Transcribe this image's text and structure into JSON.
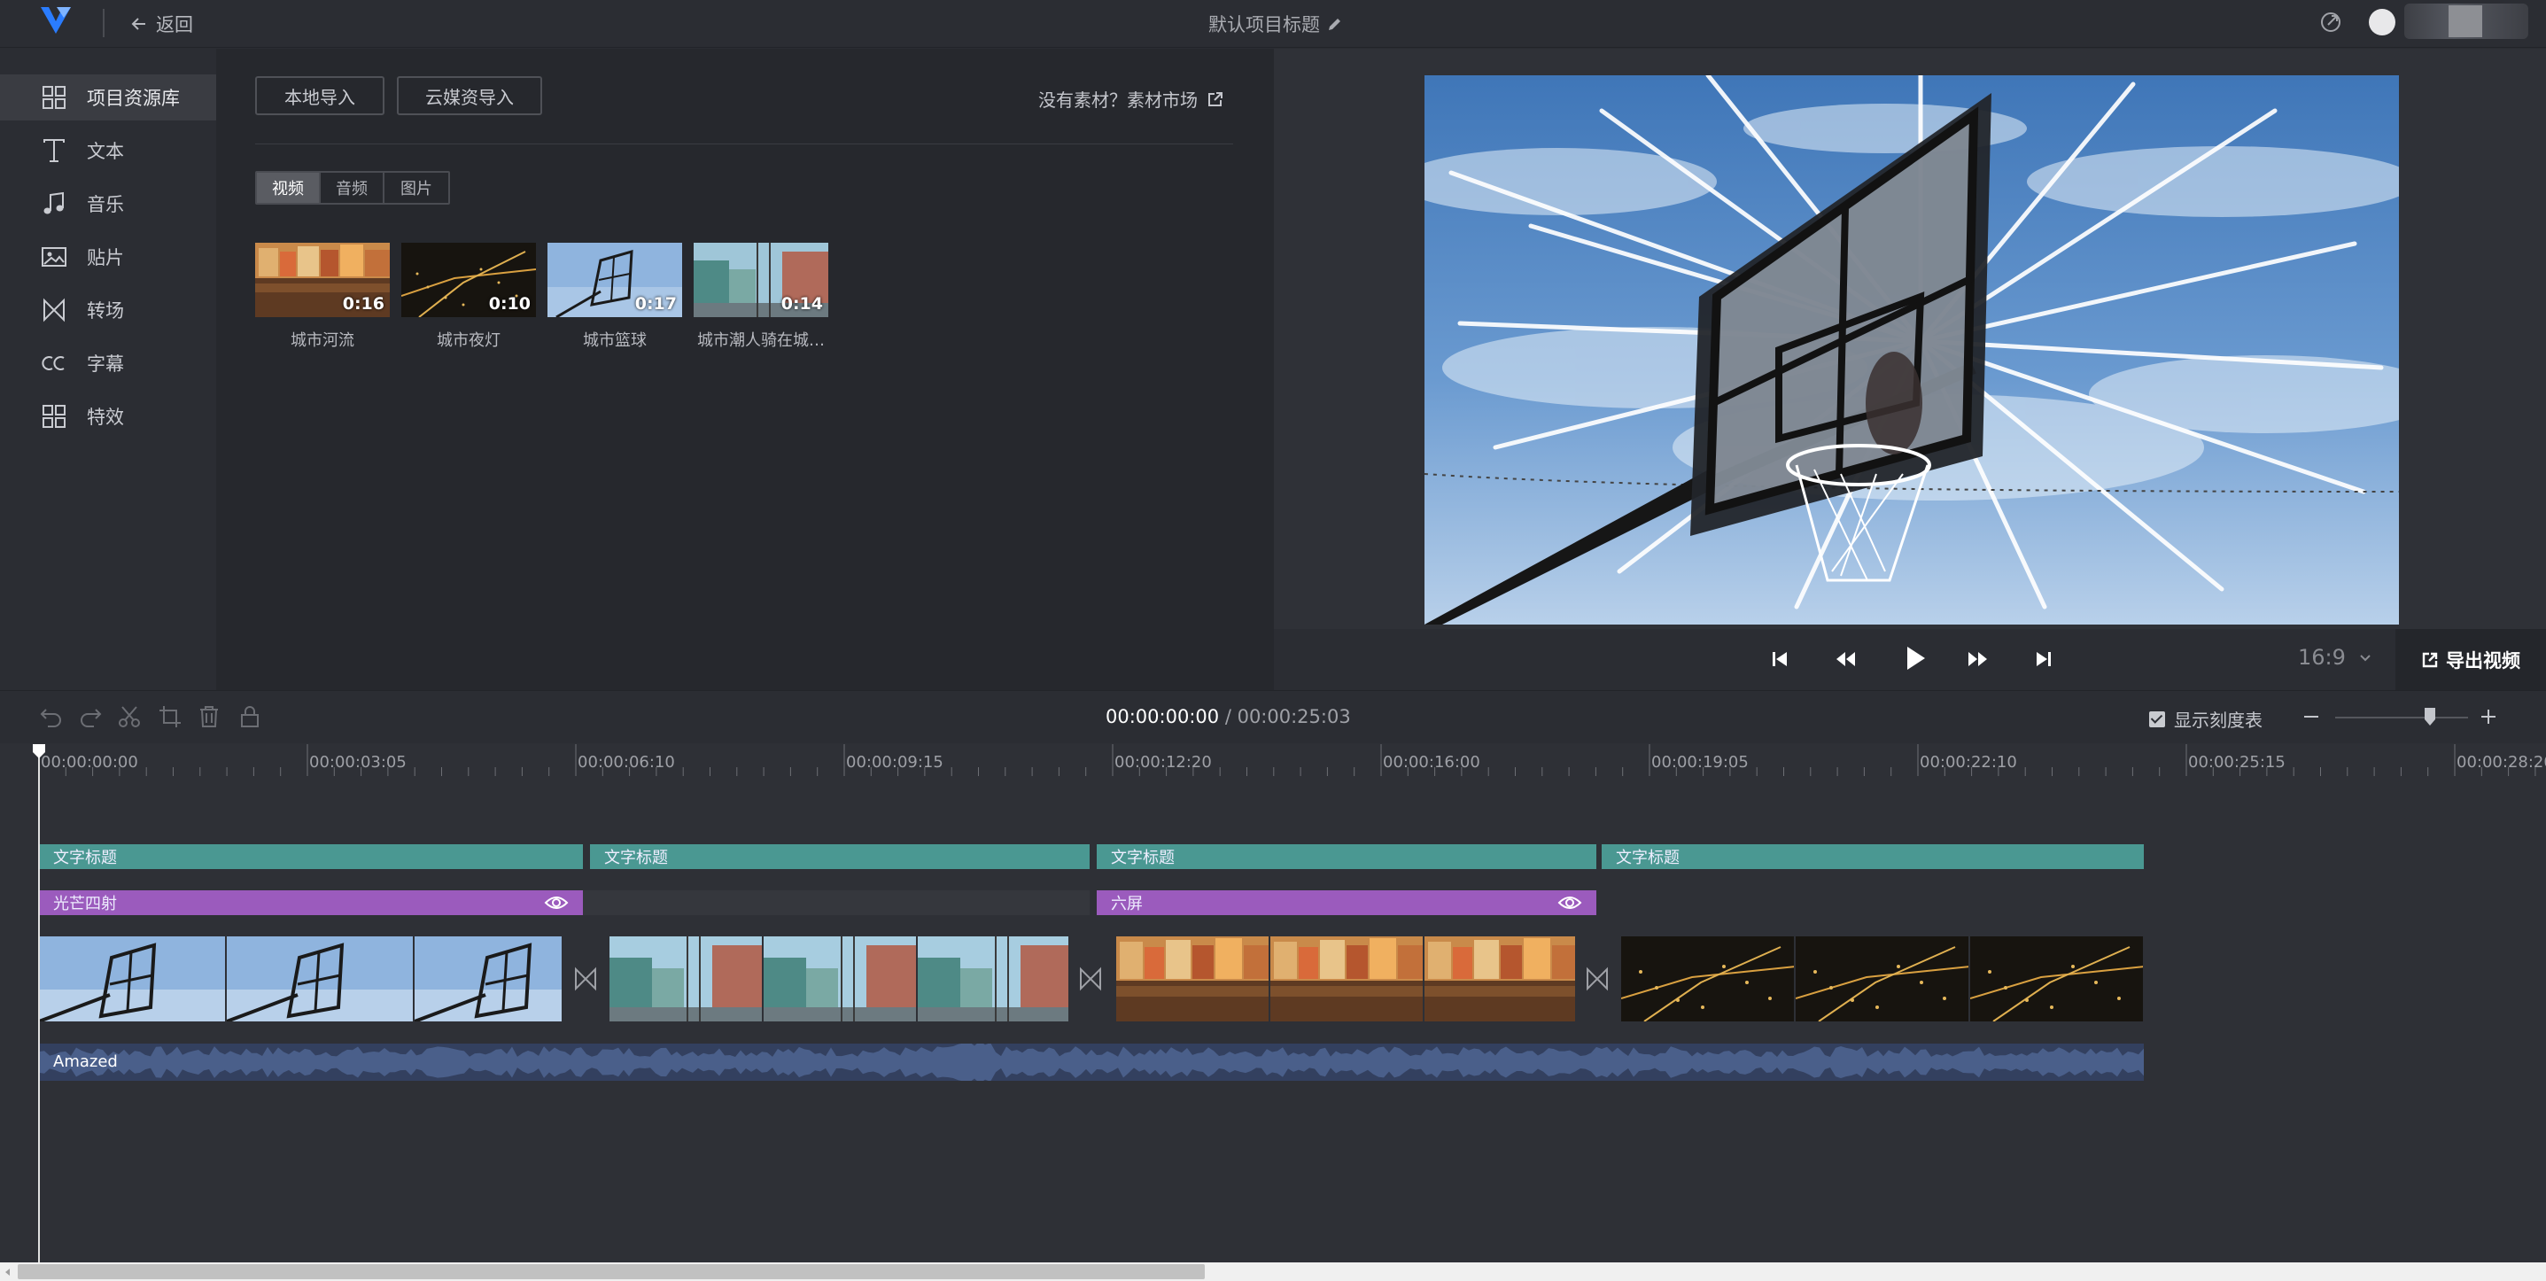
{
  "header": {
    "back_label": "返回",
    "project_title": "默认项目标题"
  },
  "sidebar": {
    "items": [
      {
        "label": "项目资源库",
        "icon": "grid-icon"
      },
      {
        "label": "文本",
        "icon": "text-t-icon"
      },
      {
        "label": "音乐",
        "icon": "music-note-icon"
      },
      {
        "label": "贴片",
        "icon": "image-icon"
      },
      {
        "label": "转场",
        "icon": "transition-icon"
      },
      {
        "label": "字幕",
        "icon": "cc-icon"
      },
      {
        "label": "特效",
        "icon": "effects-grid-icon"
      }
    ],
    "active_index": 0
  },
  "media": {
    "local_import": "本地导入",
    "cloud_import": "云媒资导入",
    "market_link": "没有素材？素材市场",
    "tabs": [
      "视频",
      "音频",
      "图片"
    ],
    "active_tab": 0,
    "items": [
      {
        "label": "城市河流",
        "duration": "0:16"
      },
      {
        "label": "城市夜灯",
        "duration": "0:10"
      },
      {
        "label": "城市篮球",
        "duration": "0:17"
      },
      {
        "label": "城市潮人骑在城…",
        "duration": "0:14"
      }
    ]
  },
  "preview": {
    "aspect_ratio": "16:9",
    "export_label": "导出视频"
  },
  "timeline": {
    "current_time": "00:00:00:00",
    "separator": "/",
    "total_time": "00:00:25:03",
    "show_ruler_label": "显示刻度表",
    "show_ruler_checked": true,
    "zoom_level": 0.68,
    "ruler_ticks": [
      "00:00:00:00",
      "00:00:03:05",
      "00:00:06:10",
      "00:00:09:15",
      "00:00:12:20",
      "00:00:16:00",
      "00:00:19:05",
      "00:00:22:10",
      "00:00:25:15",
      "00:00:28:20"
    ],
    "text_clips": [
      "文字标题",
      "文字标题",
      "文字标题",
      "文字标题"
    ],
    "effect_clips": [
      "光芒四射",
      "六屏"
    ],
    "audio_clip": "Amazed"
  },
  "colors": {
    "text_clip": "#4a9892",
    "effect_clip": "#9b5bbd",
    "audio_clip": "#33405f",
    "accent_blue": "#1e6fff"
  }
}
